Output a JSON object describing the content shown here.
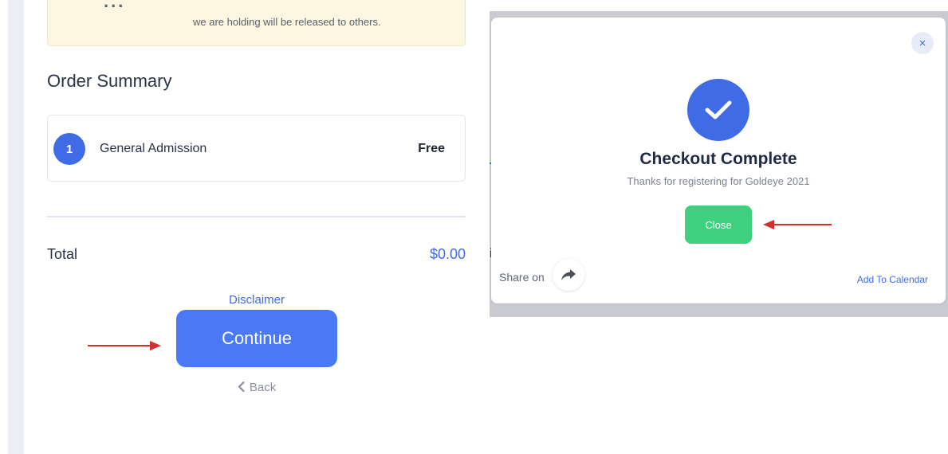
{
  "notice": {
    "clipped_text": "...",
    "text": "we are holding will be released to others."
  },
  "order_summary": {
    "heading": "Order Summary",
    "items": [
      {
        "quantity": "1",
        "name": "General Admission",
        "price": "Free"
      }
    ]
  },
  "totals": {
    "label": "Total",
    "value": "$0.00"
  },
  "actions": {
    "disclaimer_label": "Disclaimer",
    "continue_label": "Continue",
    "back_label": "Back"
  },
  "modal": {
    "close_x": "×",
    "title": "Checkout Complete",
    "subtitle": "Thanks for registering for Goldeye 2021",
    "close_label": "Close",
    "share_label": "Share on",
    "add_calendar_label": "Add To Calendar"
  },
  "peek": {
    "text": "i"
  },
  "icons": {
    "check": "check-icon",
    "share": "share-arrow-icon",
    "back": "chevron-left-icon",
    "annotation": "red-arrow-icon"
  },
  "colors": {
    "accent": "#3f6ce6",
    "continue": "#4a79f6",
    "success": "#3ed07f",
    "notice_bg": "#fdf6e1",
    "annotation": "#d32f2f"
  }
}
